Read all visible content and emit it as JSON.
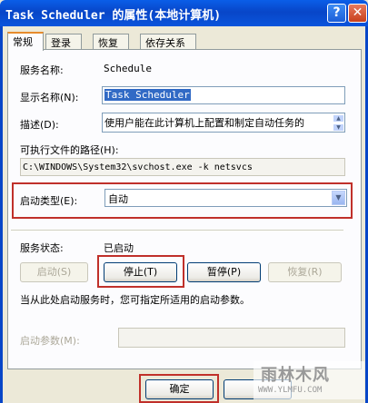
{
  "window": {
    "title": "Task Scheduler 的属性(本地计算机)",
    "help_glyph": "?",
    "close_glyph": "✕"
  },
  "tabs": [
    {
      "label": "常规",
      "active": true
    },
    {
      "label": "登录",
      "active": false
    },
    {
      "label": "恢复",
      "active": false
    },
    {
      "label": "依存关系",
      "active": false
    }
  ],
  "general": {
    "service_name_label": "服务名称:",
    "service_name": "Schedule",
    "display_name_label": "显示名称(N):",
    "display_name": "Task Scheduler",
    "description_label": "描述(D):",
    "description": "使用户能在此计算机上配置和制定自动任务的",
    "exe_path_label": "可执行文件的路径(H):",
    "exe_path": "C:\\WINDOWS\\System32\\svchost.exe -k netsvcs",
    "startup_type_label": "启动类型(E):",
    "startup_type": "自动",
    "service_status_label": "服务状态:",
    "service_status": "已启动",
    "hint": "当从此处启动服务时，您可指定所适用的启动参数。",
    "start_params_label": "启动参数(M):",
    "start_params": ""
  },
  "buttons": {
    "start": "启动(S)",
    "stop": "停止(T)",
    "pause": "暂停(P)",
    "resume": "恢复(R)",
    "ok": "确定"
  },
  "watermark": {
    "top": "雨林木风",
    "bottom": "WWW.YLMFU.COM"
  },
  "colors": {
    "titlebar": "#0a54dc",
    "highlight_box": "#c0302a",
    "selection": "#316ac5"
  }
}
